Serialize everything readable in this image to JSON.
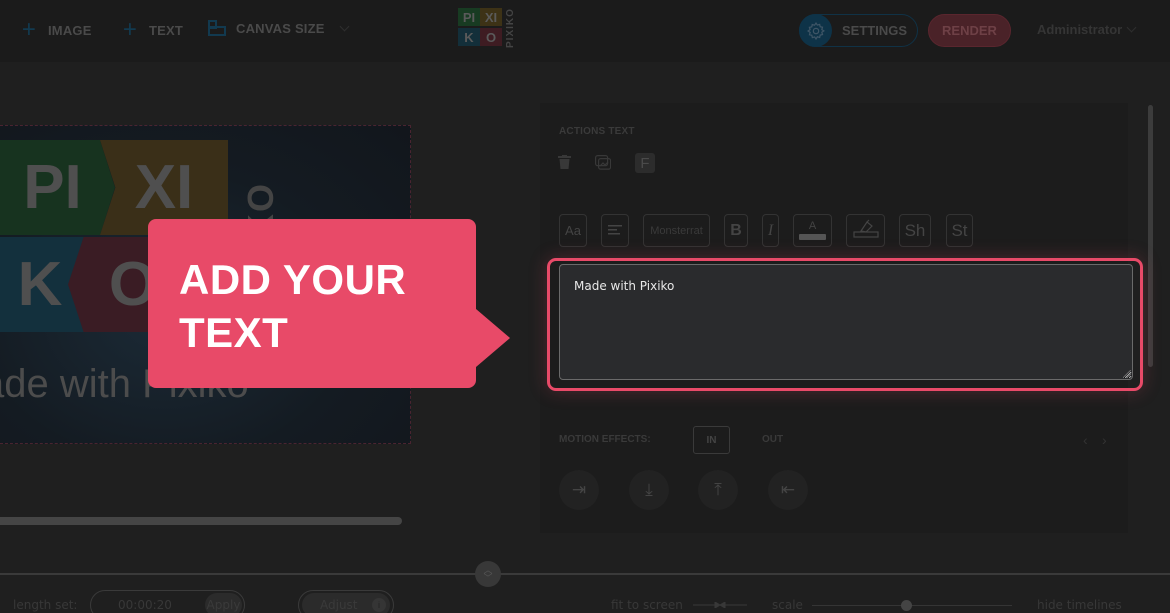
{
  "topbar": {
    "image_label": "IMAGE",
    "text_label": "TEXT",
    "canvas_size_label": "CANVAS SIZE",
    "settings_label": "SETTINGS",
    "render_label": "RENDER",
    "user_label": "Administrator",
    "logo": {
      "tiles": [
        "PI",
        "XI",
        "K",
        "O"
      ],
      "side_text": "PIXIKO"
    }
  },
  "preview": {
    "tiles": [
      "PI",
      "XI",
      "K",
      "O"
    ],
    "side_text": "KO",
    "caption": "ade with Pixiko"
  },
  "callout": {
    "line1": "ADD YOUR",
    "line2": "TEXT",
    "color": "#e84a68"
  },
  "panel": {
    "actions_title": "ACTIONS TEXT",
    "actions": [
      {
        "name": "delete",
        "icon": "trash-icon"
      },
      {
        "name": "duplicate",
        "icon": "copy-image-icon"
      },
      {
        "name": "font",
        "label": "F"
      }
    ],
    "toolbar": {
      "size_label": "Aa",
      "align_icon": "align-left-icon",
      "font_name": "Monsterrat",
      "bold_label": "B",
      "italic_label": "I",
      "color_label": "A",
      "fill_icon": "fill-bucket-icon",
      "shadow_label": "Sh",
      "stroke_label": "St"
    },
    "text_value": "Made with Pixiko",
    "motion": {
      "label": "MOTION EFFECTS:",
      "tab_in": "IN",
      "tab_out": "OUT",
      "active_tab": "IN",
      "effects": [
        {
          "name": "slide-right",
          "glyph": "⇥"
        },
        {
          "name": "slide-down",
          "glyph": "⤓"
        },
        {
          "name": "slide-up",
          "glyph": "⤒"
        },
        {
          "name": "slide-left",
          "glyph": "⇤"
        }
      ],
      "prev": "‹",
      "next": "›"
    }
  },
  "bottom": {
    "length_label": "length set:",
    "length_value": "00:00:20",
    "apply_label": "Apply",
    "adjust_label": "Adjust",
    "info_label": "i",
    "fit_label": "fit to screen",
    "scale_label": "scale",
    "scale_value_fraction": 0.47,
    "hide_label": "hide timelines"
  }
}
